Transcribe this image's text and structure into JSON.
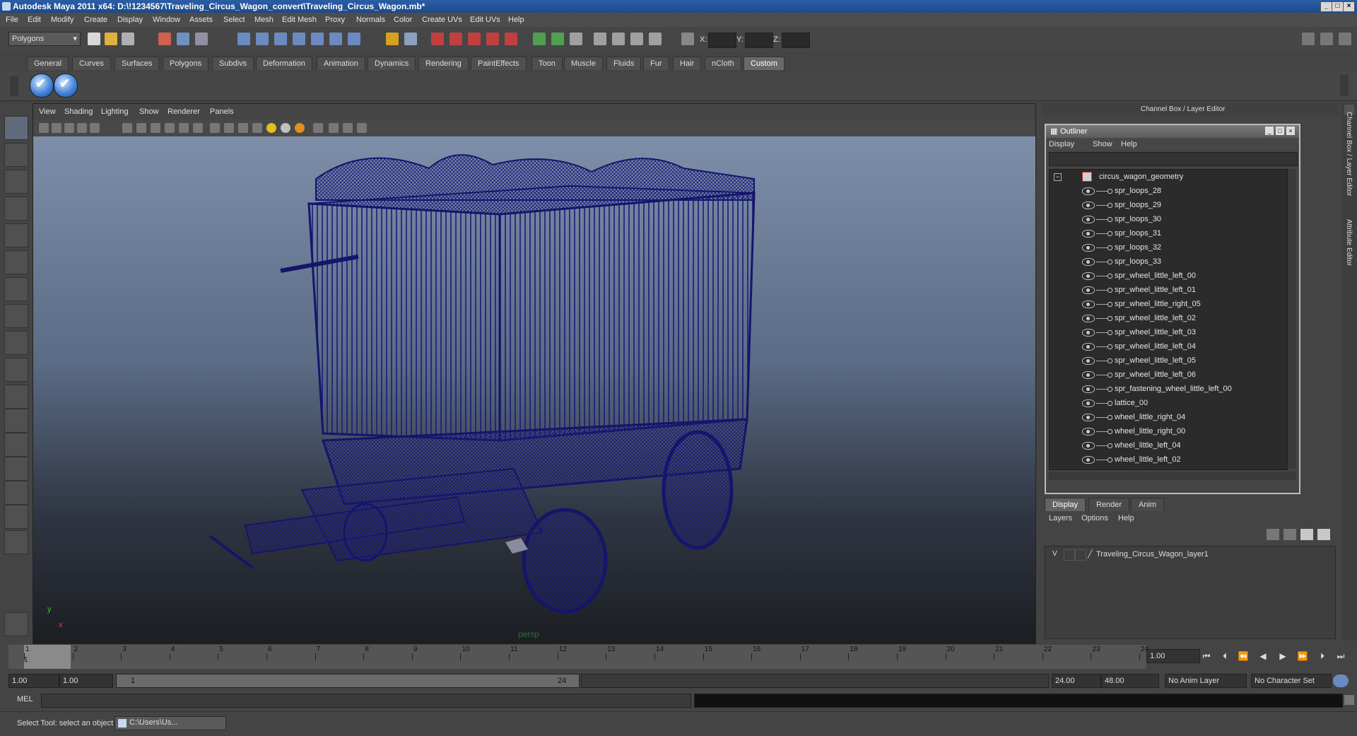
{
  "window": {
    "title": "Autodesk Maya 2011 x64: D:\\!1234567\\Traveling_Circus_Wagon_convert\\Traveling_Circus_Wagon.mb*",
    "controls": [
      "_",
      "□",
      "×"
    ]
  },
  "menubar": {
    "items": [
      "File",
      "Edit",
      "Modify",
      "Create",
      "Display",
      "Window",
      "Assets",
      "Select",
      "Mesh",
      "Edit Mesh",
      "Proxy",
      "Normals",
      "Color",
      "Create UVs",
      "Edit UVs",
      "Help"
    ]
  },
  "statusline": {
    "mode_select": "Polygons",
    "coord_labels": [
      "X:",
      "Y:",
      "Z:"
    ]
  },
  "shelf": {
    "tabs": [
      "General",
      "Curves",
      "Surfaces",
      "Polygons",
      "Subdivs",
      "Deformation",
      "Animation",
      "Dynamics",
      "Rendering",
      "PaintEffects",
      "Toon",
      "Muscle",
      "Fluids",
      "Fur",
      "Hair",
      "nCloth",
      "Custom"
    ],
    "active_tab": "Custom"
  },
  "viewport": {
    "menu": [
      "View",
      "Shading",
      "Lighting",
      "Show",
      "Renderer",
      "Panels"
    ],
    "camera_label": "persp",
    "axis": {
      "x": "x",
      "y": "y"
    },
    "wire_color": "#1a1a7a"
  },
  "channel_box": {
    "header": "Channel Box / Layer Editor"
  },
  "outliner": {
    "title": "Outliner",
    "menu": [
      "Display",
      "Show",
      "Help"
    ],
    "root": "circus_wagon_geometry",
    "items": [
      "spr_loops_28",
      "spr_loops_29",
      "spr_loops_30",
      "spr_loops_31",
      "spr_loops_32",
      "spr_loops_33",
      "spr_wheel_little_left_00",
      "spr_wheel_little_left_01",
      "spr_wheel_little_right_05",
      "spr_wheel_little_left_02",
      "spr_wheel_little_left_03",
      "spr_wheel_little_left_04",
      "spr_wheel_little_left_05",
      "spr_wheel_little_left_06",
      "spr_fastening_wheel_little_left_00",
      "lattice_00",
      "wheel_little_right_04",
      "wheel_little_right_00",
      "wheel_little_left_04",
      "wheel_little_left_02"
    ]
  },
  "layer_editor": {
    "tabs": [
      "Display",
      "Render",
      "Anim"
    ],
    "active_tab": "Display",
    "menu": [
      "Layers",
      "Options",
      "Help"
    ],
    "layers": [
      {
        "visible": "V",
        "name": "Traveling_Circus_Wagon_layer1"
      }
    ]
  },
  "side_tabs": [
    "Channel Box / Layer Editor",
    "Attribute Editor"
  ],
  "timeline": {
    "ticks": [
      "1",
      "2",
      "3",
      "4",
      "5",
      "6",
      "7",
      "8",
      "9",
      "10",
      "11",
      "12",
      "13",
      "14",
      "15",
      "16",
      "17",
      "18",
      "19",
      "20",
      "21",
      "22",
      "23",
      "24"
    ],
    "current_frame": "1.00",
    "start_label": "1"
  },
  "range": {
    "start_time": "1.00",
    "playback_start": "1.00",
    "slider_start": "1",
    "slider_end": "24",
    "playback_end": "24.00",
    "end_time": "48.00",
    "anim_layer": "No Anim Layer",
    "character_set": "No Character Set"
  },
  "command": {
    "label": "MEL"
  },
  "helpline": {
    "text": "Select Tool: select an object",
    "taskbar_item": "C:\\Users\\Us..."
  }
}
